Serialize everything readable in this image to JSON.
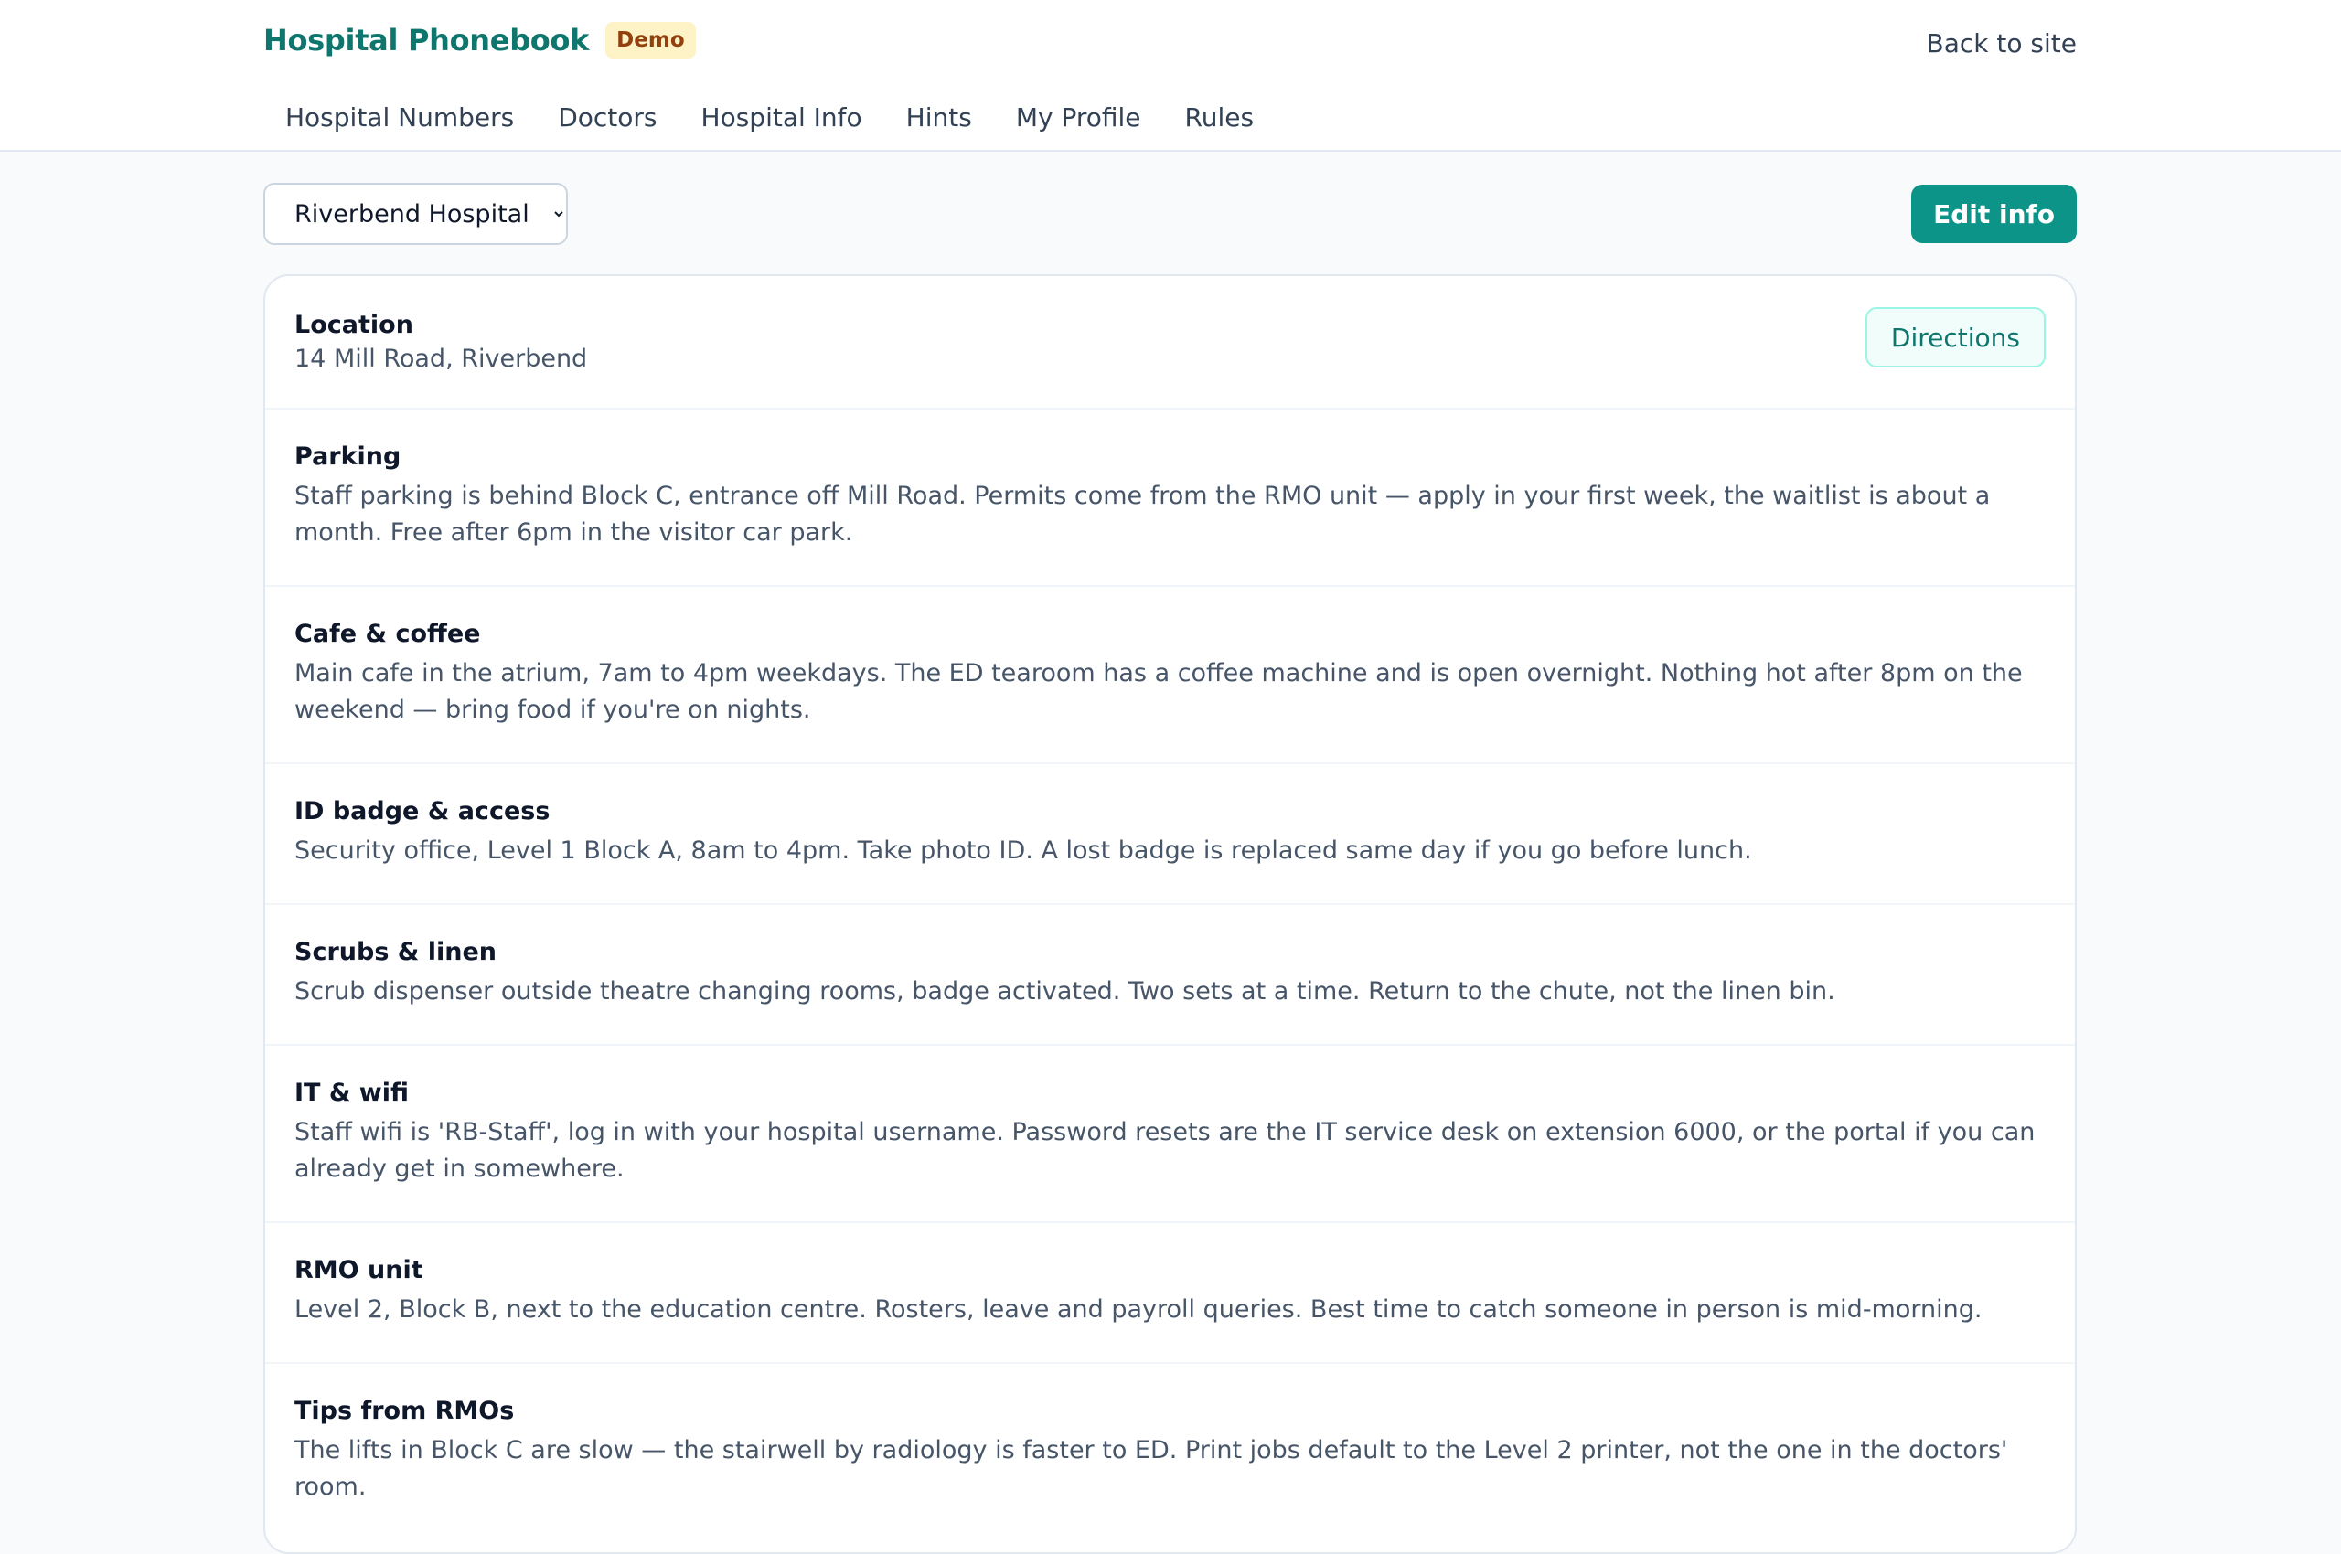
{
  "header": {
    "title": "Hospital Phonebook",
    "badge": "Demo",
    "back_link": "Back to site",
    "nav": [
      "Hospital Numbers",
      "Doctors",
      "Hospital Info",
      "Hints",
      "My Profile",
      "Rules"
    ]
  },
  "toolbar": {
    "hospital_select": "Riverbend Hospital",
    "edit_label": "Edit info"
  },
  "location": {
    "title": "Location",
    "address": "14 Mill Road, Riverbend",
    "directions_label": "Directions"
  },
  "sections": [
    {
      "title": "Parking",
      "body": "Staff parking is behind Block C, entrance off Mill Road. Permits come from the RMO unit — apply in your first week, the waitlist is about a month. Free after 6pm in the visitor car park."
    },
    {
      "title": "Cafe & coffee",
      "body": "Main cafe in the atrium, 7am to 4pm weekdays. The ED tearoom has a coffee machine and is open overnight. Nothing hot after 8pm on the weekend — bring food if you're on nights."
    },
    {
      "title": "ID badge & access",
      "body": "Security office, Level 1 Block A, 8am to 4pm. Take photo ID. A lost badge is replaced same day if you go before lunch."
    },
    {
      "title": "Scrubs & linen",
      "body": "Scrub dispenser outside theatre changing rooms, badge activated. Two sets at a time. Return to the chute, not the linen bin."
    },
    {
      "title": "IT & wifi",
      "body": "Staff wifi is 'RB-Staff', log in with your hospital username. Password resets are the IT service desk on extension 6000, or the portal if you can already get in somewhere."
    },
    {
      "title": "RMO unit",
      "body": "Level 2, Block B, next to the education centre. Rosters, leave and payroll queries. Best time to catch someone in person is mid-morning."
    },
    {
      "title": "Tips from RMOs",
      "body": "The lifts in Block C are slow — the stairwell by radiology is faster to ED. Print jobs default to the Level 2 printer, not the one in the doctors' room."
    }
  ]
}
